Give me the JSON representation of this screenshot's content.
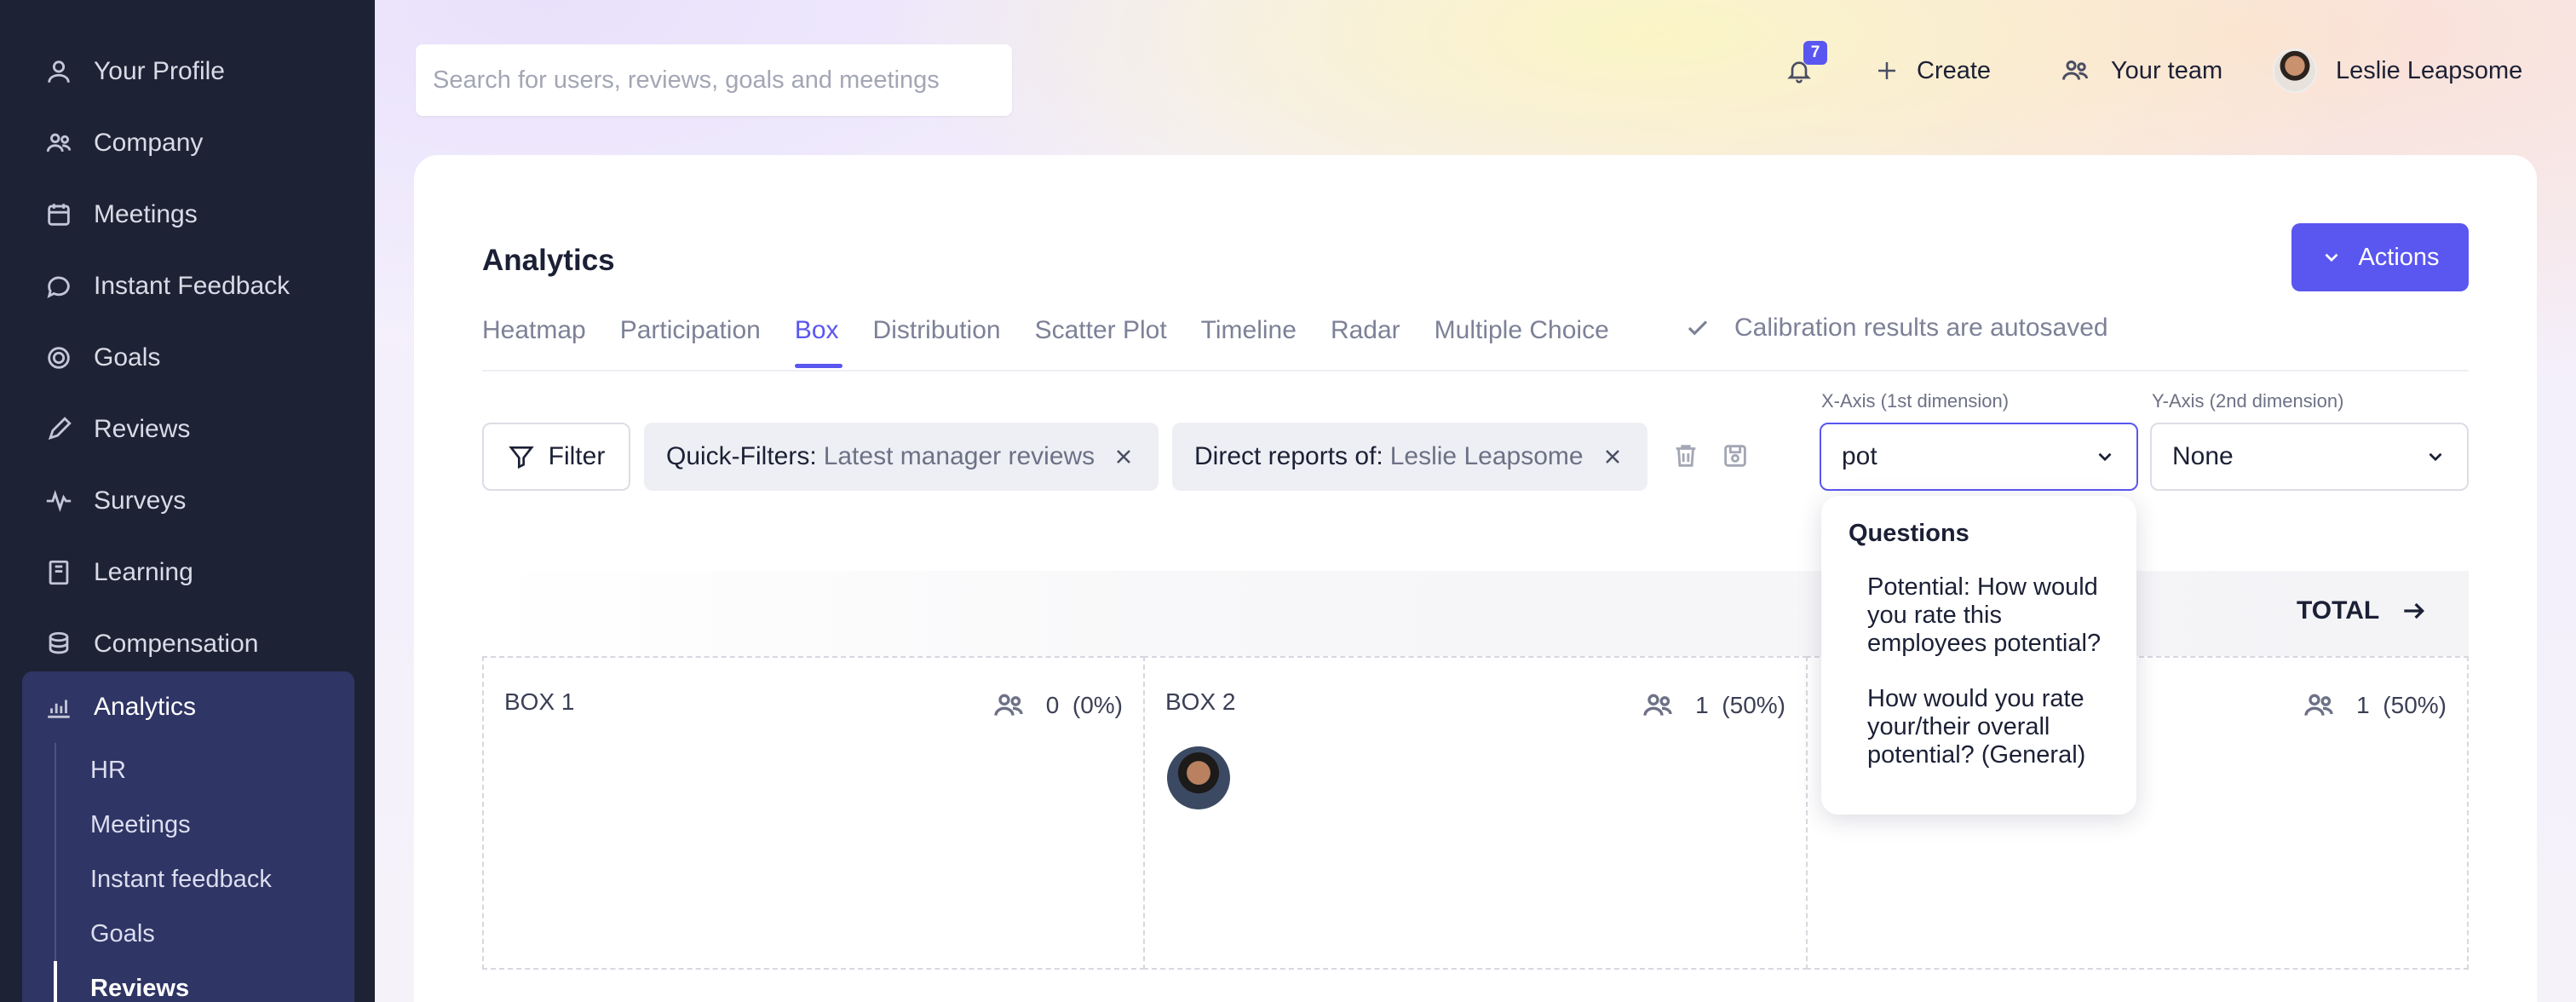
{
  "sidebar": {
    "items": [
      {
        "label": "Your Profile",
        "icon": "user-icon"
      },
      {
        "label": "Company",
        "icon": "people-icon"
      },
      {
        "label": "Meetings",
        "icon": "calendar-icon"
      },
      {
        "label": "Instant Feedback",
        "icon": "chat-icon"
      },
      {
        "label": "Goals",
        "icon": "target-icon"
      },
      {
        "label": "Reviews",
        "icon": "pencil-icon"
      },
      {
        "label": "Surveys",
        "icon": "pulse-icon"
      },
      {
        "label": "Learning",
        "icon": "book-icon"
      },
      {
        "label": "Compensation",
        "icon": "coins-icon"
      }
    ],
    "analytics": {
      "label": "Analytics",
      "sub_items": [
        "HR",
        "Meetings",
        "Instant feedback",
        "Goals",
        "Reviews"
      ],
      "active_sub": "Reviews"
    }
  },
  "topbar": {
    "search_placeholder": "Search for users, reviews, goals and meetings",
    "notifications_count": "7",
    "create_label": "Create",
    "team_label": "Your team",
    "user_name": "Leslie Leapsome"
  },
  "page": {
    "title": "Analytics",
    "actions_label": "Actions",
    "tabs": [
      "Heatmap",
      "Participation",
      "Box",
      "Distribution",
      "Scatter Plot",
      "Timeline",
      "Radar",
      "Multiple Choice"
    ],
    "active_tab": "Box",
    "autosave_text": "Calibration results are autosaved"
  },
  "filters": {
    "filter_label": "Filter",
    "chips": [
      {
        "key": "Quick-Filters:",
        "value": "Latest manager reviews"
      },
      {
        "key": "Direct reports of:",
        "value": "Leslie Leapsome"
      }
    ]
  },
  "axes": {
    "x_label": "X-Axis (1st dimension)",
    "x_value": "pot",
    "y_label": "Y-Axis (2nd dimension)",
    "y_value": "None"
  },
  "dropdown": {
    "heading": "Questions",
    "options": [
      "Potential: How would you rate this employees potential?",
      "How would you rate your/their overall potential? (General)"
    ]
  },
  "total_label": "TOTAL",
  "boxes": [
    {
      "title": "BOX 1",
      "count": "0",
      "pct": "(0%)"
    },
    {
      "title": "BOX 2",
      "count": "1",
      "pct": "(50%)"
    },
    {
      "title": "",
      "count": "1",
      "pct": "(50%)"
    }
  ],
  "colors": {
    "accent": "#5a56f0",
    "sidebar_bg": "#1e2235",
    "sidebar_active_bg": "#2f3564"
  }
}
